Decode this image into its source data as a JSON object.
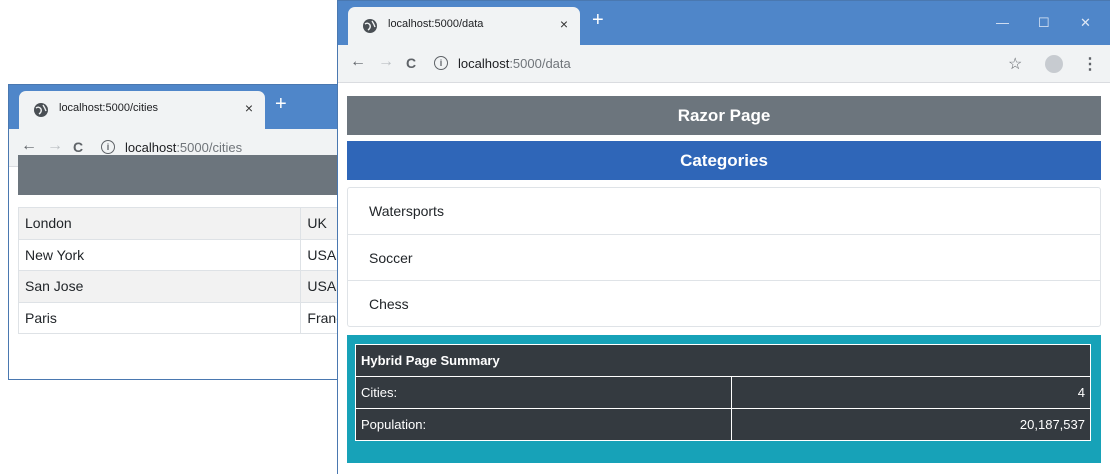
{
  "back_window": {
    "tab_title": "localhost:5000/cities",
    "tab_close": "×",
    "new_tab": "+",
    "url_host": "localhost",
    "url_path": ":5000/cities",
    "cities": [
      {
        "name": "London",
        "country": "UK"
      },
      {
        "name": "New York",
        "country": "USA"
      },
      {
        "name": "San Jose",
        "country": "USA"
      },
      {
        "name": "Paris",
        "country": "France"
      }
    ]
  },
  "front_window": {
    "tab_title": "localhost:5000/data",
    "tab_close": "×",
    "new_tab": "+",
    "url_host": "localhost",
    "url_path": ":5000/data",
    "window_controls": {
      "minimize": "—",
      "maximize": "☐",
      "close": "✕"
    },
    "heading": "Razor Page",
    "categories_heading": "Categories",
    "categories": [
      "Watersports",
      "Soccer",
      "Chess"
    ],
    "summary": {
      "title": "Hybrid Page Summary",
      "rows": [
        {
          "label": "Cities:",
          "value": "4"
        },
        {
          "label": "Population:",
          "value": "20,187,537"
        }
      ]
    }
  },
  "icons": {
    "back": "←",
    "forward": "→",
    "reload": "C",
    "info": "i",
    "star": "☆",
    "menu": "⋮"
  },
  "colors": {
    "titlebar": "#4f86c9",
    "gray_bar": "#6c757d",
    "categories_bar": "#2f66b8",
    "summary_bg": "#17a2b8",
    "summary_table": "#343a40"
  }
}
